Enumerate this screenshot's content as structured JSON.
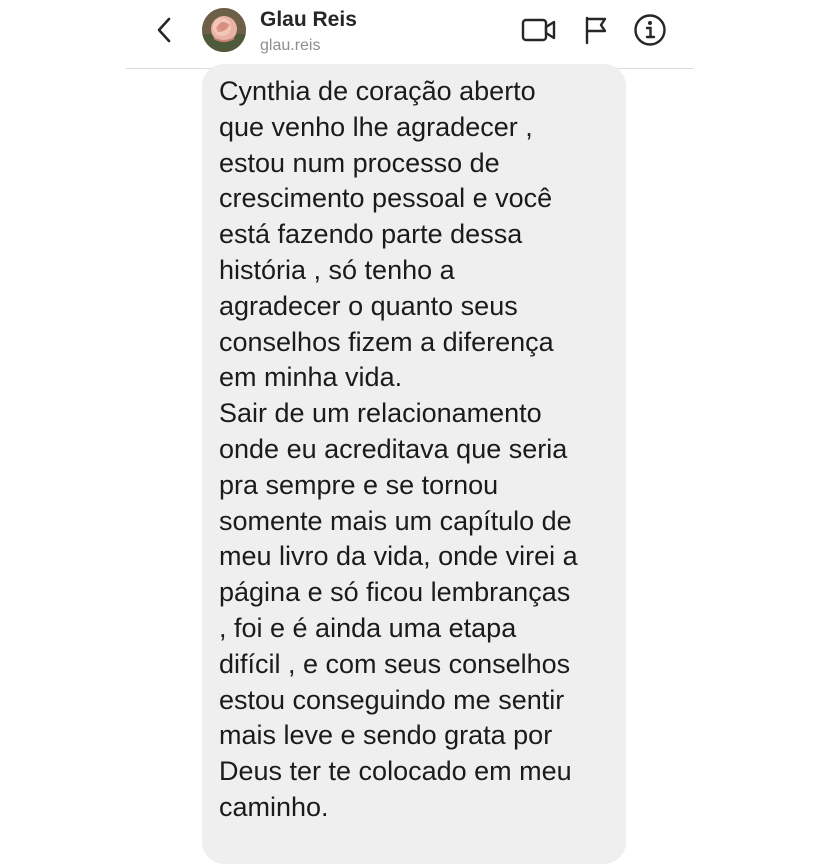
{
  "header": {
    "name": "Glau Reis",
    "handle": "glau.reis",
    "icons": {
      "back": "chevron-left-icon",
      "video": "video-camera-icon",
      "report": "flag-icon",
      "info": "info-icon"
    }
  },
  "message": {
    "lines": [
      "Cynthia de coração aberto",
      "que venho lhe agradecer ,",
      "estou num processo de",
      "crescimento pessoal e você",
      "está fazendo parte dessa",
      "história , só tenho a",
      "agradecer o quanto seus",
      "conselhos fizem a diferença",
      "em minha vida.",
      "Sair de um relacionamento",
      "onde eu acreditava que seria",
      "pra sempre e se tornou",
      "somente mais um capítulo de",
      "meu livro da vida, onde virei a",
      "página e só ficou lembranças",
      ", foi e é ainda uma etapa",
      "difícil , e com seus conselhos",
      "estou conseguindo me sentir",
      "mais leve e sendo grata por",
      "Deus ter te colocado em meu",
      "caminho."
    ]
  },
  "colors": {
    "bubble": "#efefef",
    "text": "#1b1b1b",
    "handle": "#8e8e8e"
  }
}
